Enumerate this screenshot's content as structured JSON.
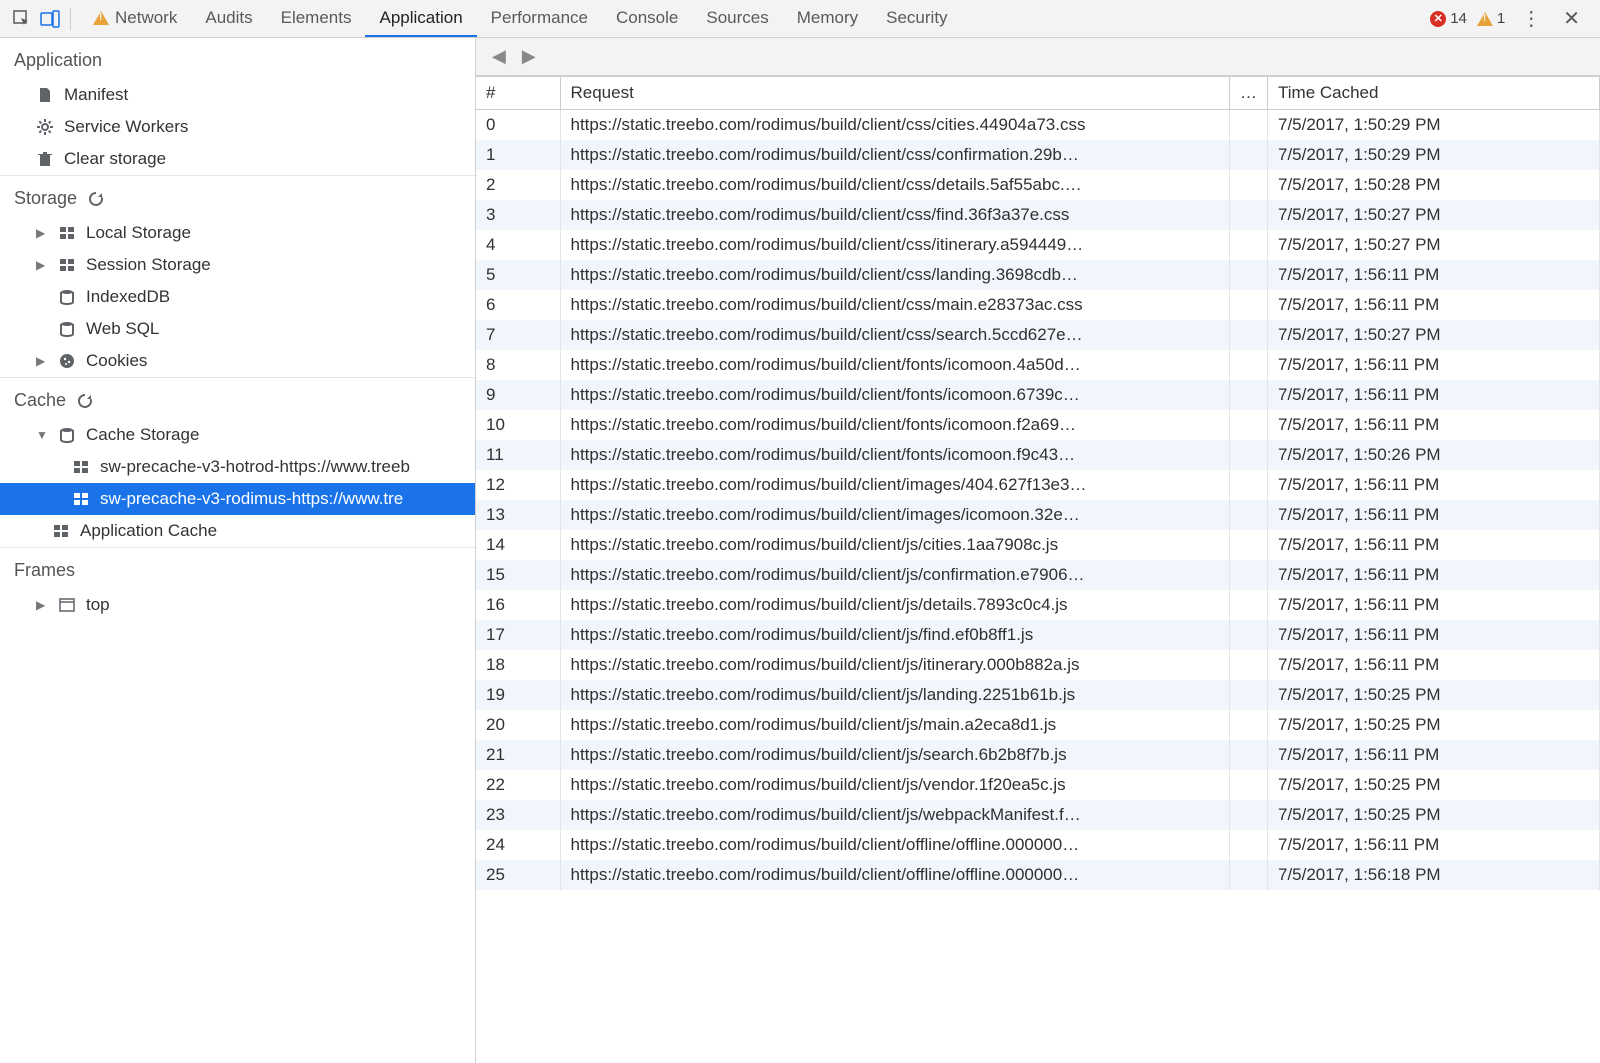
{
  "toolbar": {
    "tabs": [
      "Network",
      "Audits",
      "Elements",
      "Application",
      "Performance",
      "Console",
      "Sources",
      "Memory",
      "Security"
    ],
    "active_tab": "Application",
    "warn_tab": "Network",
    "errors": "14",
    "warnings": "1"
  },
  "sidebar": {
    "application": {
      "title": "Application",
      "items": [
        "Manifest",
        "Service Workers",
        "Clear storage"
      ]
    },
    "storage": {
      "title": "Storage",
      "items": [
        "Local Storage",
        "Session Storage",
        "IndexedDB",
        "Web SQL",
        "Cookies"
      ]
    },
    "cache": {
      "title": "Cache",
      "storage_label": "Cache Storage",
      "entries": [
        "sw-precache-v3-hotrod-https://www.treeb",
        "sw-precache-v3-rodimus-https://www.tre"
      ],
      "selected_index": 1,
      "app_cache_label": "Application Cache"
    },
    "frames": {
      "title": "Frames",
      "items": [
        "top"
      ]
    }
  },
  "table": {
    "headers": {
      "num": "#",
      "request": "Request",
      "dots": "…",
      "time": "Time Cached"
    },
    "rows": [
      {
        "n": "0",
        "req": "https://static.treebo.com/rodimus/build/client/css/cities.44904a73.css",
        "t": "7/5/2017, 1:50:29 PM"
      },
      {
        "n": "1",
        "req": "https://static.treebo.com/rodimus/build/client/css/confirmation.29b…",
        "t": "7/5/2017, 1:50:29 PM"
      },
      {
        "n": "2",
        "req": "https://static.treebo.com/rodimus/build/client/css/details.5af55abc.…",
        "t": "7/5/2017, 1:50:28 PM"
      },
      {
        "n": "3",
        "req": "https://static.treebo.com/rodimus/build/client/css/find.36f3a37e.css",
        "t": "7/5/2017, 1:50:27 PM"
      },
      {
        "n": "4",
        "req": "https://static.treebo.com/rodimus/build/client/css/itinerary.a594449…",
        "t": "7/5/2017, 1:50:27 PM"
      },
      {
        "n": "5",
        "req": "https://static.treebo.com/rodimus/build/client/css/landing.3698cdb…",
        "t": "7/5/2017, 1:56:11 PM"
      },
      {
        "n": "6",
        "req": "https://static.treebo.com/rodimus/build/client/css/main.e28373ac.css",
        "t": "7/5/2017, 1:56:11 PM"
      },
      {
        "n": "7",
        "req": "https://static.treebo.com/rodimus/build/client/css/search.5ccd627e…",
        "t": "7/5/2017, 1:50:27 PM"
      },
      {
        "n": "8",
        "req": "https://static.treebo.com/rodimus/build/client/fonts/icomoon.4a50d…",
        "t": "7/5/2017, 1:56:11 PM"
      },
      {
        "n": "9",
        "req": "https://static.treebo.com/rodimus/build/client/fonts/icomoon.6739c…",
        "t": "7/5/2017, 1:56:11 PM"
      },
      {
        "n": "10",
        "req": "https://static.treebo.com/rodimus/build/client/fonts/icomoon.f2a69…",
        "t": "7/5/2017, 1:56:11 PM"
      },
      {
        "n": "11",
        "req": "https://static.treebo.com/rodimus/build/client/fonts/icomoon.f9c43…",
        "t": "7/5/2017, 1:50:26 PM"
      },
      {
        "n": "12",
        "req": "https://static.treebo.com/rodimus/build/client/images/404.627f13e3…",
        "t": "7/5/2017, 1:56:11 PM"
      },
      {
        "n": "13",
        "req": "https://static.treebo.com/rodimus/build/client/images/icomoon.32e…",
        "t": "7/5/2017, 1:56:11 PM"
      },
      {
        "n": "14",
        "req": "https://static.treebo.com/rodimus/build/client/js/cities.1aa7908c.js",
        "t": "7/5/2017, 1:56:11 PM"
      },
      {
        "n": "15",
        "req": "https://static.treebo.com/rodimus/build/client/js/confirmation.e7906…",
        "t": "7/5/2017, 1:56:11 PM"
      },
      {
        "n": "16",
        "req": "https://static.treebo.com/rodimus/build/client/js/details.7893c0c4.js",
        "t": "7/5/2017, 1:56:11 PM"
      },
      {
        "n": "17",
        "req": "https://static.treebo.com/rodimus/build/client/js/find.ef0b8ff1.js",
        "t": "7/5/2017, 1:56:11 PM"
      },
      {
        "n": "18",
        "req": "https://static.treebo.com/rodimus/build/client/js/itinerary.000b882a.js",
        "t": "7/5/2017, 1:56:11 PM"
      },
      {
        "n": "19",
        "req": "https://static.treebo.com/rodimus/build/client/js/landing.2251b61b.js",
        "t": "7/5/2017, 1:50:25 PM"
      },
      {
        "n": "20",
        "req": "https://static.treebo.com/rodimus/build/client/js/main.a2eca8d1.js",
        "t": "7/5/2017, 1:50:25 PM"
      },
      {
        "n": "21",
        "req": "https://static.treebo.com/rodimus/build/client/js/search.6b2b8f7b.js",
        "t": "7/5/2017, 1:56:11 PM"
      },
      {
        "n": "22",
        "req": "https://static.treebo.com/rodimus/build/client/js/vendor.1f20ea5c.js",
        "t": "7/5/2017, 1:50:25 PM"
      },
      {
        "n": "23",
        "req": "https://static.treebo.com/rodimus/build/client/js/webpackManifest.f…",
        "t": "7/5/2017, 1:50:25 PM"
      },
      {
        "n": "24",
        "req": "https://static.treebo.com/rodimus/build/client/offline/offline.000000…",
        "t": "7/5/2017, 1:56:11 PM"
      },
      {
        "n": "25",
        "req": "https://static.treebo.com/rodimus/build/client/offline/offline.000000…",
        "t": "7/5/2017, 1:56:18 PM"
      }
    ]
  }
}
